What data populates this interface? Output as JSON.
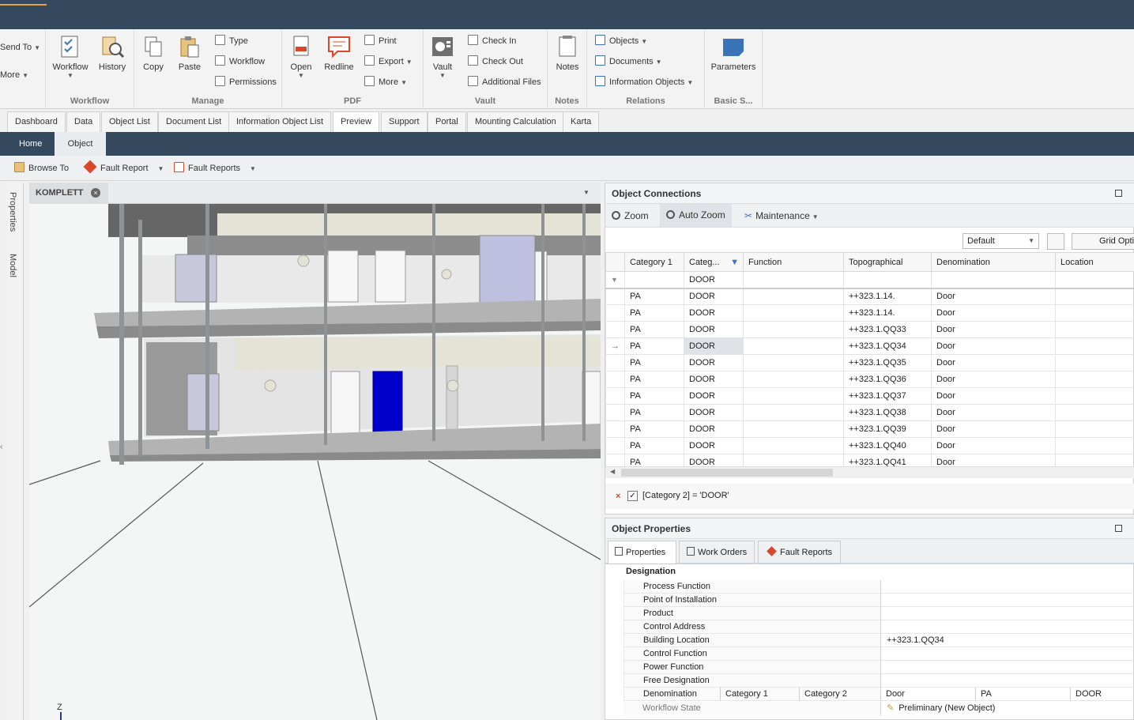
{
  "ribbon": {
    "partial": {
      "send_to": "Send To",
      "more": "More"
    },
    "workflow_group": {
      "label": "Workflow",
      "workflow": "Workflow",
      "history": "History"
    },
    "manage_group": {
      "label": "Manage",
      "copy": "Copy",
      "paste": "Paste",
      "type": "Type",
      "workflow": "Workflow",
      "permissions": "Permissions"
    },
    "pdf_group": {
      "label": "PDF",
      "open": "Open",
      "redline": "Redline",
      "print": "Print",
      "export": "Export",
      "more": "More"
    },
    "vault_group": {
      "label": "Vault",
      "vault": "Vault",
      "check_in": "Check In",
      "check_out": "Check Out",
      "additional_files": "Additional Files"
    },
    "notes_group": {
      "label": "Notes",
      "notes": "Notes"
    },
    "relations_group": {
      "label": "Relations",
      "objects": "Objects",
      "documents": "Documents",
      "information_objects": "Information Objects"
    },
    "basic_group": {
      "label": "Basic S...",
      "parameters": "Parameters"
    }
  },
  "doc_tabs": [
    "Dashboard",
    "Data",
    "Object List",
    "Document List",
    "Information Object List",
    "Preview",
    "Support",
    "Portal",
    "Mounting Calculation",
    "Karta"
  ],
  "sub_tabs": [
    "Home",
    "Object"
  ],
  "toolbar": {
    "browse_to": "Browse To",
    "fault_report": "Fault Report",
    "fault_reports": "Fault Reports"
  },
  "side_tabs": {
    "properties": "Properties",
    "model": "Model"
  },
  "viewer": {
    "tab_title": "KOMPLETT",
    "axis_label": "Z"
  },
  "object_connections": {
    "title": "Object Connections",
    "zoom": "Zoom",
    "auto_zoom": "Auto Zoom",
    "maintenance": "Maintenance",
    "layout_select": "Default",
    "grid_options": "Grid Opti",
    "columns": [
      "Category 1",
      "Categ...",
      "Function",
      "Topographical",
      "Denomination",
      "Location"
    ],
    "filter_value": "DOOR",
    "rows": [
      [
        "PA",
        "DOOR",
        "",
        "++323.1.14.",
        "Door",
        ""
      ],
      [
        "PA",
        "DOOR",
        "",
        "++323.1.14.",
        "Door",
        ""
      ],
      [
        "PA",
        "DOOR",
        "",
        "++323.1.QQ33",
        "Door",
        ""
      ],
      [
        "PA",
        "DOOR",
        "",
        "++323.1.QQ34",
        "Door",
        ""
      ],
      [
        "PA",
        "DOOR",
        "",
        "++323.1.QQ35",
        "Door",
        ""
      ],
      [
        "PA",
        "DOOR",
        "",
        "++323.1.QQ36",
        "Door",
        ""
      ],
      [
        "PA",
        "DOOR",
        "",
        "++323.1.QQ37",
        "Door",
        ""
      ],
      [
        "PA",
        "DOOR",
        "",
        "++323.1.QQ38",
        "Door",
        ""
      ],
      [
        "PA",
        "DOOR",
        "",
        "++323.1.QQ39",
        "Door",
        ""
      ],
      [
        "PA",
        "DOOR",
        "",
        "++323.1.QQ40",
        "Door",
        ""
      ],
      [
        "PA",
        "DOOR",
        "",
        "++323.1.QQ41",
        "Door",
        ""
      ]
    ],
    "selected_row": 3,
    "filter_expression": "[Category 2] = 'DOOR'"
  },
  "object_properties": {
    "title": "Object Properties",
    "tabs": [
      "Properties",
      "Work Orders",
      "Fault Reports"
    ],
    "section": "Designation",
    "fields": [
      {
        "label": "Process Function",
        "value": ""
      },
      {
        "label": "Point of Installation",
        "value": ""
      },
      {
        "label": "Product",
        "value": ""
      },
      {
        "label": "Control Address",
        "value": ""
      },
      {
        "label": "Building Location",
        "value": "++323.1.QQ34"
      },
      {
        "label": "Control Function",
        "value": ""
      },
      {
        "label": "Power Function",
        "value": ""
      },
      {
        "label": "Free Designation",
        "value": ""
      }
    ],
    "denomination": {
      "label": "Denomination",
      "cat1_label": "Category 1",
      "cat2_label": "Category 2",
      "value": "Door",
      "cat1": "PA",
      "cat2": "DOOR"
    },
    "workflow_state": {
      "label": "Workflow State",
      "value": "Preliminary (New Object)"
    }
  },
  "colors": {
    "header": "#34495e",
    "accent": "#e8a33a",
    "selected_door": "#0000cc",
    "ribbon_icon_blue": "#3b73b9",
    "ribbon_icon_red": "#d9482b"
  }
}
